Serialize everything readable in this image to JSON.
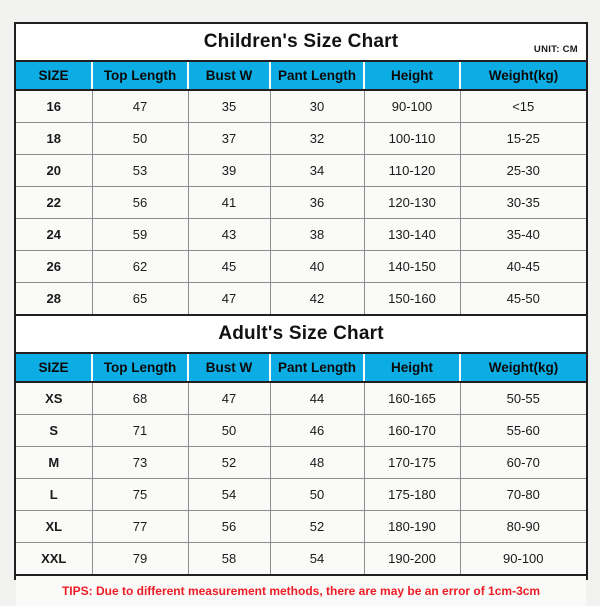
{
  "children_chart": {
    "title": "Children's Size Chart",
    "unit": "UNIT: CM",
    "columns": [
      "SIZE",
      "Top Length",
      "Bust W",
      "Pant Length",
      "Height",
      "Weight(kg)"
    ],
    "rows": [
      [
        "16",
        "47",
        "35",
        "30",
        "90-100",
        "<15"
      ],
      [
        "18",
        "50",
        "37",
        "32",
        "100-110",
        "15-25"
      ],
      [
        "20",
        "53",
        "39",
        "34",
        "110-120",
        "25-30"
      ],
      [
        "22",
        "56",
        "41",
        "36",
        "120-130",
        "30-35"
      ],
      [
        "24",
        "59",
        "43",
        "38",
        "130-140",
        "35-40"
      ],
      [
        "26",
        "62",
        "45",
        "40",
        "140-150",
        "40-45"
      ],
      [
        "28",
        "65",
        "47",
        "42",
        "150-160",
        "45-50"
      ]
    ]
  },
  "adult_chart": {
    "title": "Adult's Size Chart",
    "columns": [
      "SIZE",
      "Top Length",
      "Bust W",
      "Pant Length",
      "Height",
      "Weight(kg)"
    ],
    "rows": [
      [
        "XS",
        "68",
        "47",
        "44",
        "160-165",
        "50-55"
      ],
      [
        "S",
        "71",
        "50",
        "46",
        "160-170",
        "55-60"
      ],
      [
        "M",
        "73",
        "52",
        "48",
        "170-175",
        "60-70"
      ],
      [
        "L",
        "75",
        "54",
        "50",
        "175-180",
        "70-80"
      ],
      [
        "XL",
        "77",
        "56",
        "52",
        "180-190",
        "80-90"
      ],
      [
        "XXL",
        "79",
        "58",
        "54",
        "190-200",
        "90-100"
      ]
    ]
  },
  "tips": "TIPS: Due to different measurement methods, there are may be an error of 1cm-3cm",
  "colors": {
    "header_blue": "#0cade4",
    "tips_red": "#ee1c25",
    "border_dark": "#231f20",
    "cell_bg": "#fafaf8"
  }
}
